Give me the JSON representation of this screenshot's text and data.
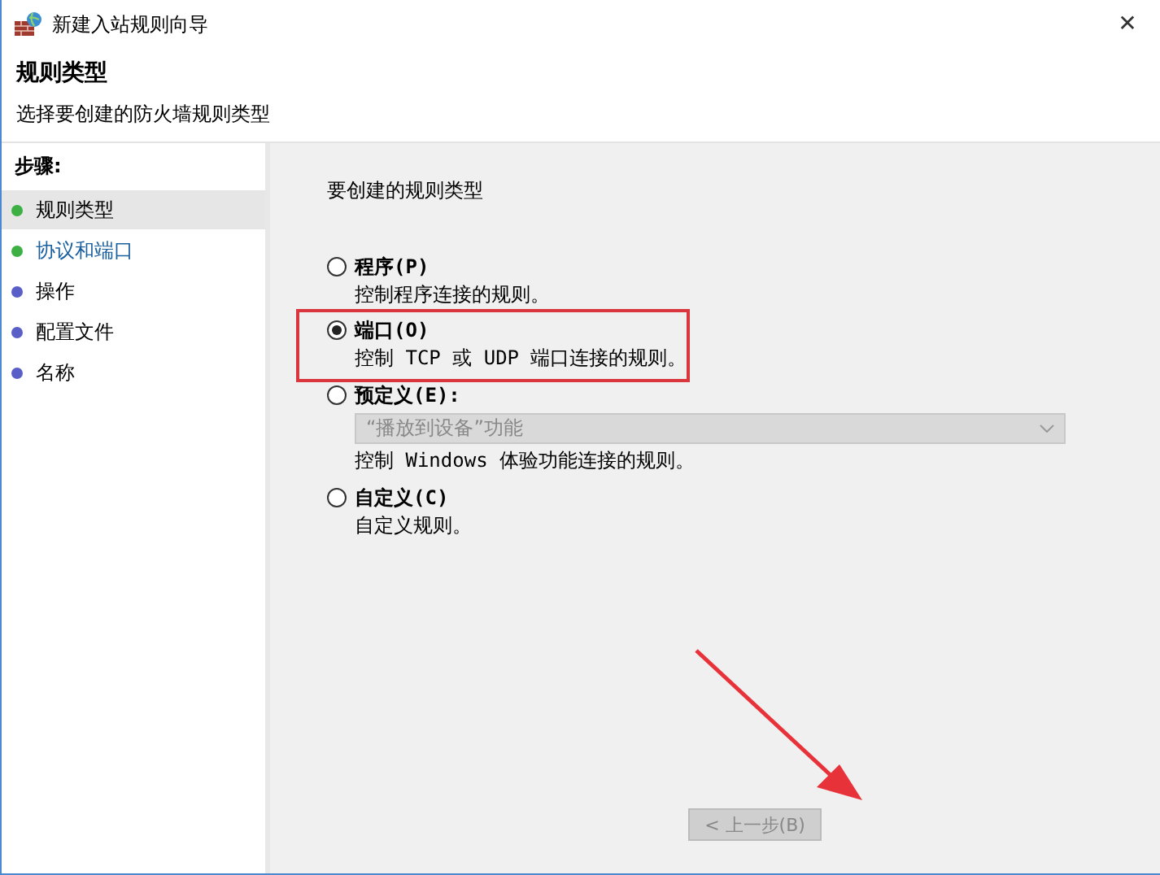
{
  "window": {
    "title": "新建入站规则向导",
    "close": "✕"
  },
  "header": {
    "title": "规则类型",
    "subtitle": "选择要创建的防火墙规则类型"
  },
  "steps": {
    "heading": "步骤:",
    "items": [
      {
        "label": "规则类型",
        "color": "#3cb043",
        "selected": true,
        "hover": false
      },
      {
        "label": "协议和端口",
        "color": "#3cb043",
        "selected": false,
        "hover": true
      },
      {
        "label": "操作",
        "color": "#5a5fc8",
        "selected": false,
        "hover": false
      },
      {
        "label": "配置文件",
        "color": "#5a5fc8",
        "selected": false,
        "hover": false
      },
      {
        "label": "名称",
        "color": "#5a5fc8",
        "selected": false,
        "hover": false
      }
    ]
  },
  "prompt": "要创建的规则类型",
  "options": [
    {
      "label": "程序(P)",
      "description": "控制程序连接的规则。",
      "selected": false,
      "framed": false
    },
    {
      "label": "端口(O)",
      "description": "控制 TCP 或 UDP 端口连接的规则。",
      "selected": true,
      "framed": true
    },
    {
      "label": "预定义(E):",
      "dropdown": {
        "value": "“播放到设备”功能",
        "disabled": true
      },
      "description": "控制 Windows 体验功能连接的规则。",
      "selected": false,
      "framed": false
    },
    {
      "label": "自定义(C)",
      "description": "自定义规则。",
      "selected": false,
      "framed": false
    }
  ],
  "buttons": [
    {
      "label": "< 上一步(B)",
      "disabled": true
    }
  ],
  "annotations": [
    {
      "kind": "arrow"
    }
  ]
}
